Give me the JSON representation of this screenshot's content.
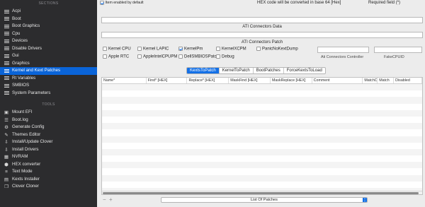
{
  "sidebar": {
    "sections_header": "SECTIONS",
    "items": [
      {
        "label": "Acpi"
      },
      {
        "label": "Boot"
      },
      {
        "label": "Boot Graphics"
      },
      {
        "label": "Cpu"
      },
      {
        "label": "Devices"
      },
      {
        "label": "Disable Drivers"
      },
      {
        "label": "Gui"
      },
      {
        "label": "Graphics"
      },
      {
        "label": "Kernel and Kext Patches"
      },
      {
        "label": "Rt Variables"
      },
      {
        "label": "SMBIOS"
      },
      {
        "label": "System Parameters"
      }
    ],
    "selected_index": 8,
    "tools_header": "TOOLS",
    "tools": [
      {
        "label": "Mount EFI",
        "icon": "disk-icon"
      },
      {
        "label": "Boot.log",
        "icon": "document-icon"
      },
      {
        "label": "Generate Config",
        "icon": "gear-icon"
      },
      {
        "label": "Themes Editor",
        "icon": "brush-icon"
      },
      {
        "label": "Install/Update Clover",
        "icon": "download-icon"
      },
      {
        "label": "Install Drivers",
        "icon": "download-icon"
      },
      {
        "label": "NVRAM",
        "icon": "chip-icon"
      },
      {
        "label": "HEX converter",
        "icon": "hex-icon"
      },
      {
        "label": "Text Mode",
        "icon": "text-icon"
      },
      {
        "label": "Kexts Installer",
        "icon": "package-icon"
      },
      {
        "label": "Clover Cloner",
        "icon": "clone-icon"
      }
    ]
  },
  "topbar": {
    "item_enabled_label": "Item enabled by default",
    "item_enabled_checked": true,
    "hex_note": "HEX code will be converted in base 64 [Hex]",
    "required_note": "Required field (*)"
  },
  "ati": {
    "connectors_data_label": "ATI Connectors Data",
    "connectors_patch_label": "ATI Connectors Patch",
    "connectors_controller_label": "Ati Connectors Controller",
    "fake_cpuid_label": "FakeCPUID"
  },
  "kernel_patches": {
    "row1": [
      {
        "label": "Kernel CPU",
        "checked": false
      },
      {
        "label": "Kernel LAPIC",
        "checked": false
      },
      {
        "label": "KernelPm",
        "checked": true
      },
      {
        "label": "KernelXCPM",
        "checked": false
      },
      {
        "label": "PanicNoKextDump",
        "checked": false
      }
    ],
    "row2": [
      {
        "label": "Apple RTC",
        "checked": false
      },
      {
        "label": "AppleIntelCPUPM",
        "checked": false
      },
      {
        "label": "DellSMBIOSPatch",
        "checked": false
      },
      {
        "label": "Debug",
        "checked": false
      }
    ]
  },
  "tabs": [
    {
      "label": "KextsToPatch",
      "active": true
    },
    {
      "label": "KernelToPatch",
      "active": false
    },
    {
      "label": "BootPatches",
      "active": false
    },
    {
      "label": "ForceKextsToLoad",
      "active": false
    }
  ],
  "table": {
    "columns": [
      "Name*",
      "Find* [HEX]",
      "Replace* [HEX]",
      "MaskFind [HEX]",
      "MaskReplace [HEX]",
      "Comment",
      "MatchOS",
      "Match",
      "Disabled"
    ],
    "rows": []
  },
  "bottom": {
    "add_label": "+",
    "remove_label": "−",
    "popup_value": "List Of Patches"
  },
  "colors": {
    "accent": "#1470e6",
    "sidebar_bg": "#2c2c2e",
    "sidebar_selected": "#0a64d8"
  }
}
